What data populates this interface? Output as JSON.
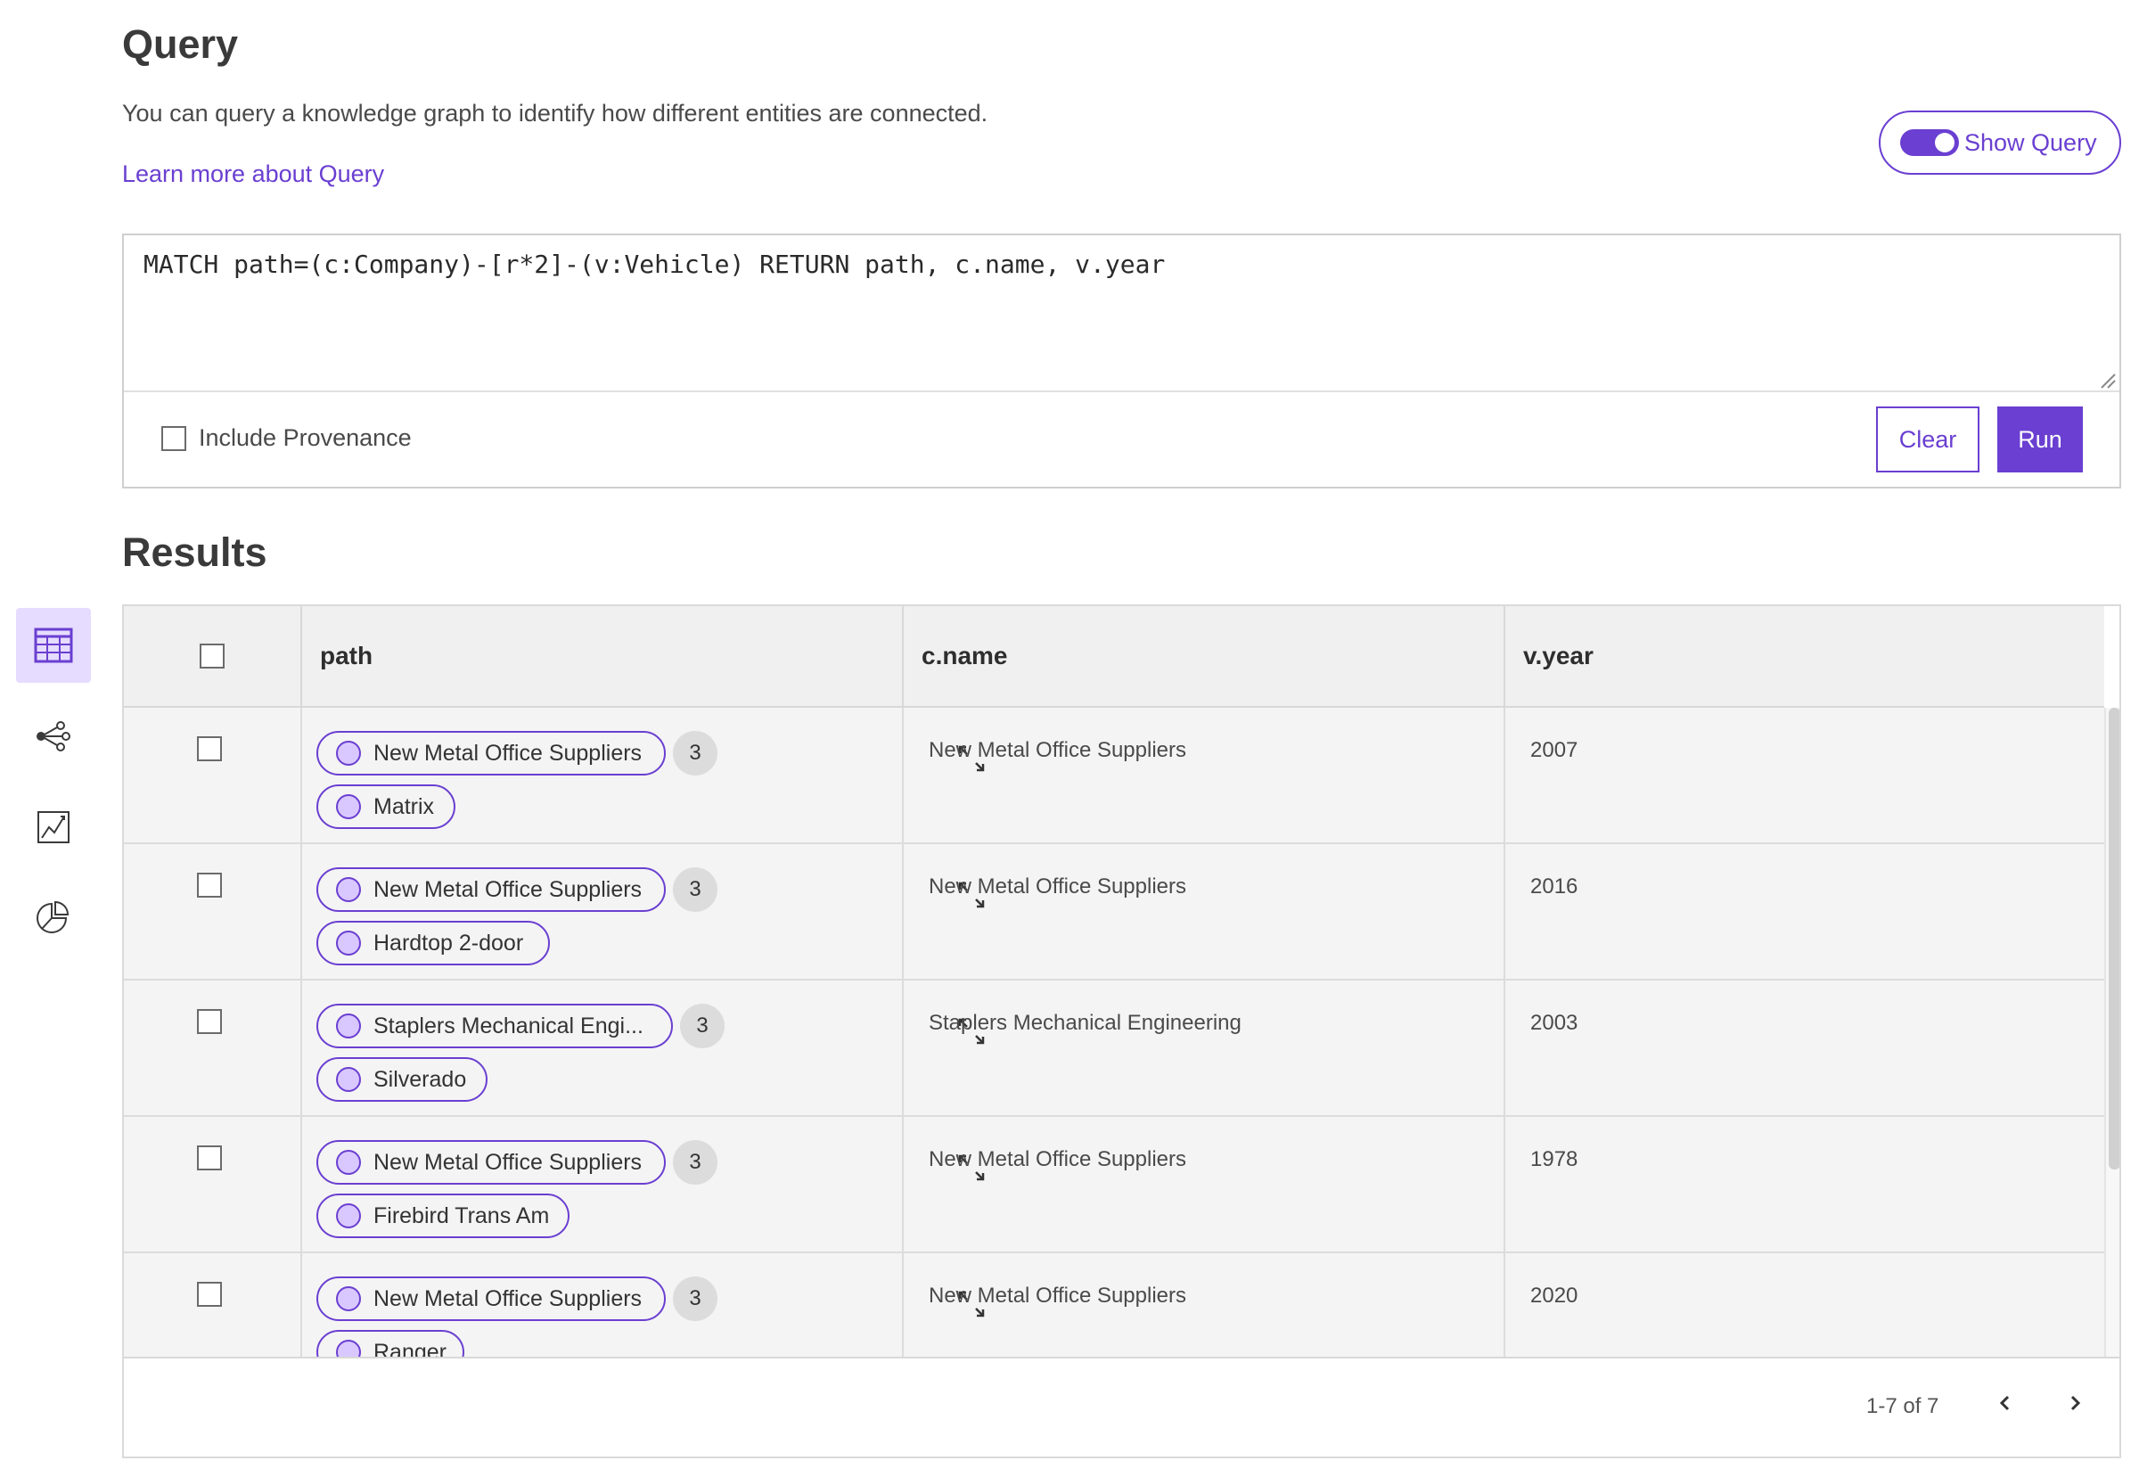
{
  "query": {
    "title": "Query",
    "description": "You can query a knowledge graph to identify how different entities are connected.",
    "learn_more": "Learn more about Query",
    "show_query_label": "Show Query",
    "show_query_on": true,
    "text": "MATCH path=(c:Company)-[r*2]-(v:Vehicle) RETURN path, c.name, v.year",
    "include_provenance": "Include Provenance",
    "clear_label": "Clear",
    "run_label": "Run"
  },
  "results": {
    "title": "Results",
    "columns": [
      "path",
      "c.name",
      "v.year"
    ],
    "rows": [
      {
        "start": "New Metal Office Suppliers",
        "count": "3",
        "end": "Matrix",
        "name": "New Metal Office Suppliers",
        "year": "2007"
      },
      {
        "start": "New Metal Office Suppliers",
        "count": "3",
        "end": "Hardtop 2-door",
        "name": "New Metal Office Suppliers",
        "year": "2016"
      },
      {
        "start": "Staplers Mechanical Engi...",
        "count": "3",
        "end": "Silverado",
        "name": "Staplers Mechanical Engineering",
        "year": "2003"
      },
      {
        "start": "New Metal Office Suppliers",
        "count": "3",
        "end": "Firebird Trans Am",
        "name": "New Metal Office Suppliers",
        "year": "1978"
      },
      {
        "start": "New Metal Office Suppliers",
        "count": "3",
        "end": "Ranger",
        "name": "New Metal Office Suppliers",
        "year": "2020"
      }
    ],
    "pager": "1-7 of 7"
  },
  "side_nav": [
    "table-view-icon",
    "graph-view-icon",
    "chart-view-icon",
    "pie-chart-icon"
  ],
  "colors": {
    "accent": "#6a3fd1",
    "accent_light": "#e6dcff",
    "row_bg": "#f4f4f4"
  }
}
